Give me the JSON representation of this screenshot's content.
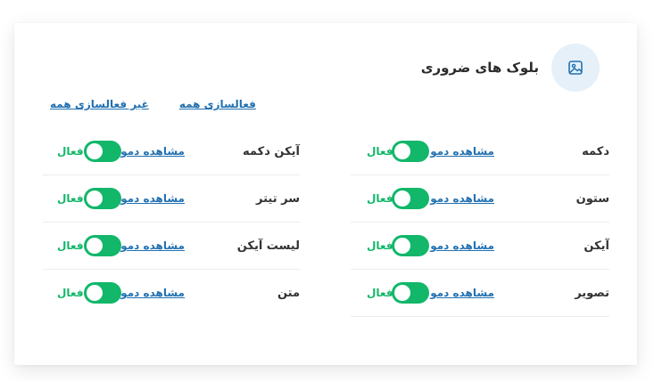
{
  "header": {
    "title": "بلوک های ضروری",
    "icon": "image-icon",
    "accent": "#2271b1",
    "icon_bg": "#e6f0f9"
  },
  "actions": {
    "activate_all": "فعالسازی همه",
    "deactivate_all": "غیر فعالسازی همه"
  },
  "toggle_color": "#12b76a",
  "right_column": [
    {
      "name": "دکمه",
      "demo": "مشاهده دمو",
      "status": "فعال",
      "enabled": true
    },
    {
      "name": "ستون",
      "demo": "مشاهده دمو",
      "status": "فعال",
      "enabled": true
    },
    {
      "name": "آیکن",
      "demo": "مشاهده دمو",
      "status": "فعال",
      "enabled": true
    },
    {
      "name": "تصویر",
      "demo": "مشاهده دمو",
      "status": "فعال",
      "enabled": true
    }
  ],
  "left_column": [
    {
      "name": "آیکن دکمه",
      "demo": "مشاهده دمو",
      "status": "فعال",
      "enabled": true
    },
    {
      "name": "سر تیتر",
      "demo": "مشاهده دمو",
      "status": "فعال",
      "enabled": true
    },
    {
      "name": "لیست آیکن",
      "demo": "مشاهده دمو",
      "status": "فعال",
      "enabled": true
    },
    {
      "name": "متن",
      "demo": "مشاهده دمو",
      "status": "فعال",
      "enabled": true
    }
  ]
}
